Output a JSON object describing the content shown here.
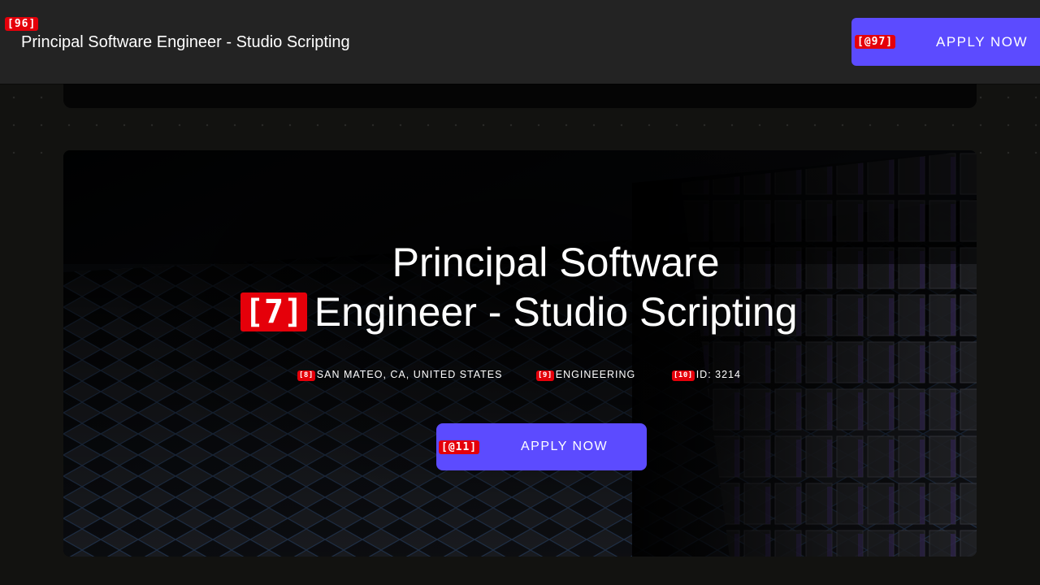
{
  "header": {
    "marker": "[96]",
    "title": "Principal Software Engineer - Studio Scripting",
    "apply_marker": "[@97]",
    "apply_label": "APPLY NOW"
  },
  "hero": {
    "title_marker": "[7]",
    "title": "Principal Software Engineer - Studio Scripting",
    "location_marker": "[8]",
    "location": "SAN MATEO, CA, UNITED STATES",
    "department_marker": "[9]",
    "department": "ENGINEERING",
    "id_marker": "[10]",
    "job_id": "ID: 3214",
    "apply_marker": "[@11]",
    "apply_label": "APPLY NOW"
  },
  "theme": {
    "accent": "#5c4bff",
    "badge": "#e5000a",
    "header_bg": "#232323",
    "page_bg": "#121210"
  },
  "icons": {
    "hero_background": "dark-3d-cube-pattern-image"
  }
}
